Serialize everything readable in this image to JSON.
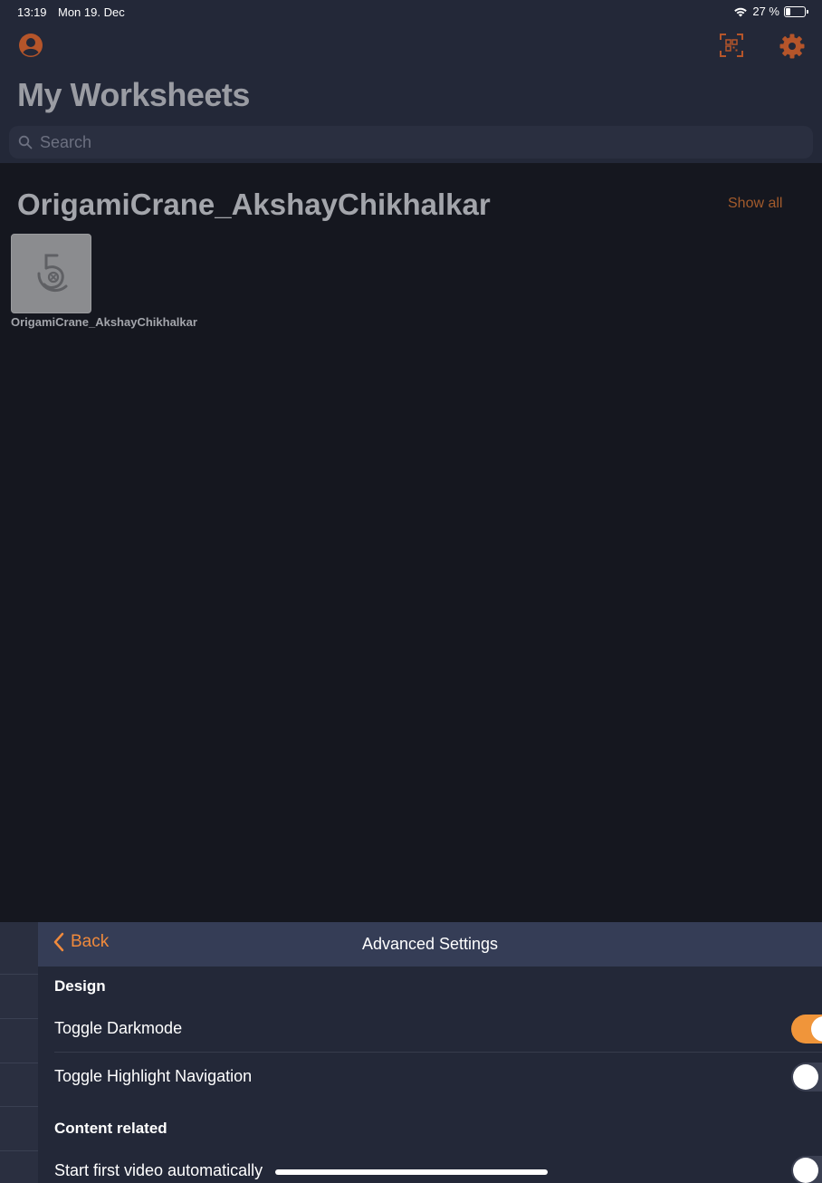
{
  "status_bar": {
    "time": "13:19",
    "date": "Mon 19. Dec",
    "battery_text": "27 %",
    "battery_level": 0.27
  },
  "header": {
    "title": "My Worksheets",
    "account_icon": "person-circle-icon",
    "qr_icon": "qr-scan-icon",
    "settings_icon": "gear-icon"
  },
  "search": {
    "placeholder": "Search"
  },
  "collection": {
    "title": "OrigamiCrane_AkshayChikhalkar",
    "show_all": "Show all",
    "items": [
      {
        "label": "OrigamiCrane_AkshayChikhalkar",
        "icon": "worksheet-logo-icon"
      }
    ]
  },
  "settings_sheet": {
    "back_label": "Back",
    "title": "Advanced Settings",
    "groups": [
      {
        "heading": "Design",
        "rows": [
          {
            "label": "Toggle Darkmode",
            "on": true
          },
          {
            "label": "Toggle Highlight Navigation",
            "on": false
          }
        ]
      },
      {
        "heading": "Content related",
        "rows": [
          {
            "label": "Start first video automatically",
            "on": false
          }
        ]
      }
    ]
  },
  "colors": {
    "accent": "#f0953a",
    "accent_muted": "#a35b2c",
    "header_bg": "#232838",
    "body_bg": "#15171f",
    "sheet_header_bg": "#353d56"
  }
}
